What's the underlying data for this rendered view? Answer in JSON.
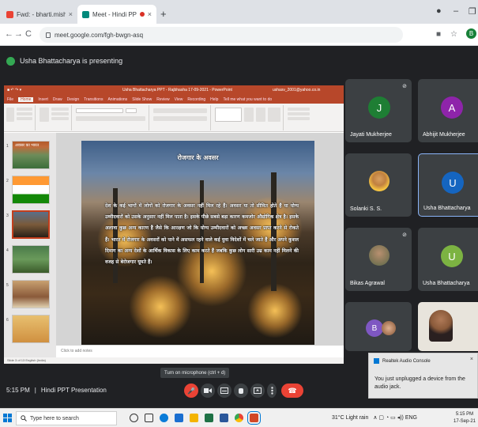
{
  "browser": {
    "tabs": [
      {
        "title": "Fwd: - bharti.mishra@nift.ac.in",
        "close": "×"
      },
      {
        "title": "Meet - Hindi PPT Presentati...",
        "close": "×"
      }
    ],
    "new_tab": "+",
    "window_controls": {
      "user": "●",
      "minimize": "–",
      "restore": "❐"
    },
    "nav": {
      "back": "←",
      "forward": "→",
      "reload": "C"
    },
    "url": "meet.google.com/fgh-bwgn-asq",
    "icons": {
      "cast": "■",
      "star": "☆"
    },
    "profile_initial": "B"
  },
  "meet": {
    "presenter_banner": "Usha Bhattacharya is presenting",
    "meeting_time": "5:15 PM",
    "meeting_separator": "|",
    "meeting_name": "Hindi PPT Presentation",
    "tooltip": "Turn on microphone (ctrl + d)",
    "participants": [
      {
        "name": "Jayati Mukherjee",
        "initial": "J",
        "color": "#1e7e34"
      },
      {
        "name": "Abhijit Mukherjee",
        "initial": "A",
        "color": "#8e24aa"
      },
      {
        "name": "Solanki S. S.",
        "initial": "",
        "color": "#f6c542"
      },
      {
        "name": "Usha Bhattacharya",
        "initial": "U",
        "color": "#1565c0"
      },
      {
        "name": "Bikas Agrawal",
        "initial": "",
        "color": "#7a8a6a"
      },
      {
        "name": "Usha Bhattacharya",
        "initial": "U",
        "color": "#7cb342"
      },
      {
        "name": "",
        "initial": "B",
        "color": "#7e57c2"
      }
    ],
    "controls": {
      "mic": "🎤",
      "end_call": "☎"
    }
  },
  "powerpoint": {
    "window_title": "Usha Bhattacharya PPT - Rajbhasha 17-09-2021  -  PowerPoint",
    "account": "ushasv_2001@yahoo.co.in",
    "tabs": [
      "File",
      "Home",
      "Insert",
      "Draw",
      "Design",
      "Transitions",
      "Animations",
      "Slide Show",
      "Review",
      "View",
      "Recording",
      "Help",
      "Tell me what you want to do"
    ],
    "thumb_title": "अवसर का भारत",
    "slide_title": "रोजगार के अवसर",
    "slide_body": "देश के कई भागों में लोगों को रोजगार के अवसर नहीं मिल रहे हैं। अवसर या तो सीमित होते हैं या योग्य उम्मीदवारों को उसके अनुसार नहीं मिल पाता है। इसके पीछे सबसे बड़ा कारण कमजोर औद्योगिक क्षेत्र है। इसके अलावा कुछ अन्य कारण हैं जैसे कि आरक्षण जो कि योग्य उम्मीदवारों को अच्छा अवसर प्राप्त करने से रोकते हैं। भारत में रोजगार के अवसरों को पाने में असफल रहने वाले कई युवा विदेशों में चले जाते हैं और अपने कुशल दिमाग का अन्य देशों के आर्थिक विकास के लिए काम करते हैं जबकि कुछ लोग सारी उम्र काम नहीं मिलने की वजह से बेरोजगार घूमते हैं।",
    "notes_placeholder": "Click to add notes",
    "status": "Slide 3 of 13    English (India)"
  },
  "notification": {
    "app": "Realtek Audio Console",
    "message": "You just unplugged a device from the audio jack.",
    "close": "×"
  },
  "taskbar": {
    "search_placeholder": "Type here to search",
    "weather": "31°C  Light rain",
    "tray_icons": "∧ ▢ ◔ ▭ ◂)) ENG",
    "time": "5:15 PM",
    "date": "17-Sep-21"
  }
}
